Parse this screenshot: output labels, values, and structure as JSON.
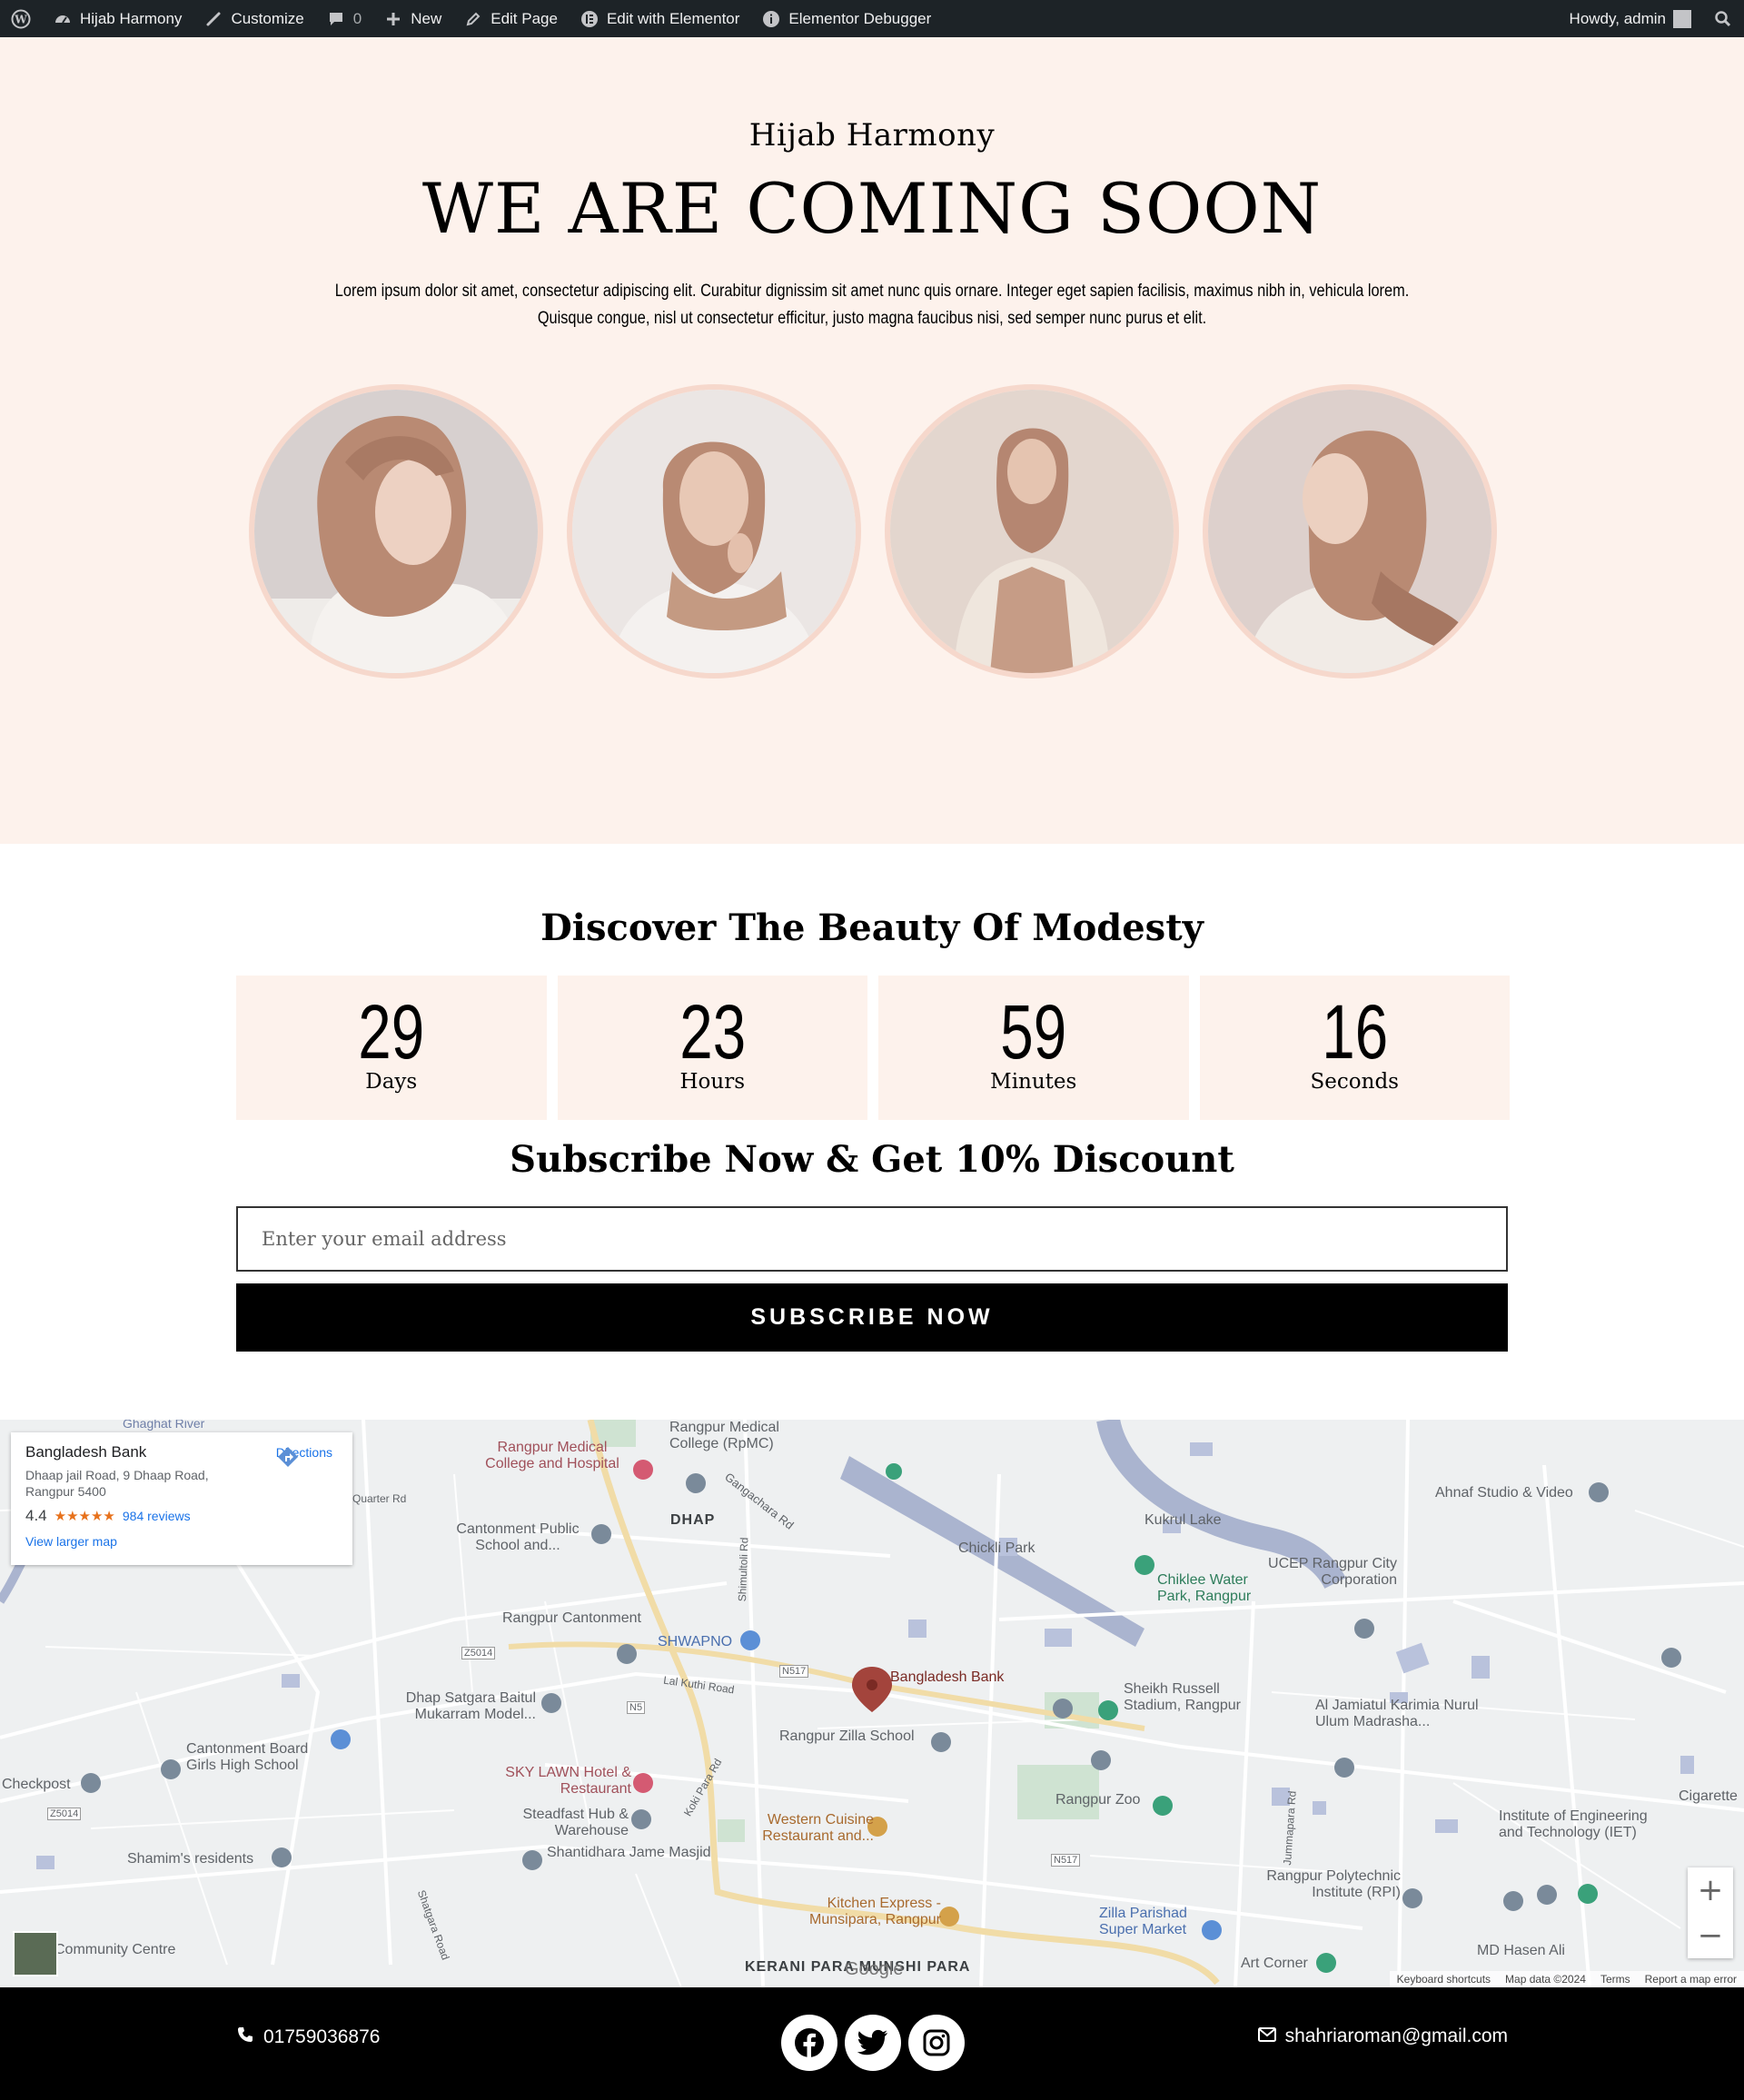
{
  "adminbar": {
    "site_name": "Hijab Harmony",
    "customize": "Customize",
    "comments_count": "0",
    "new": "New",
    "edit_page": "Edit Page",
    "edit_elementor": "Edit with Elementor",
    "debugger": "Elementor Debugger",
    "howdy": "Howdy, admin"
  },
  "hero": {
    "brand": "Hijab Harmony",
    "headline": "WE ARE COMING SOON",
    "description": "Lorem ipsum dolor sit amet, consectetur adipiscing elit. Curabitur dignissim sit amet nunc quis ornare. Integer eget sapien facilisis, maximus nibh in, vehicula lorem. Quisque congue, nisl ut consectetur efficitur, justo magna faucibus nisi, sed semper nunc purus et elit."
  },
  "countdown": {
    "title": "Discover The Beauty Of Modesty",
    "items": [
      {
        "value": "29",
        "label": "Days"
      },
      {
        "value": "23",
        "label": "Hours"
      },
      {
        "value": "59",
        "label": "Minutes"
      },
      {
        "value": "16",
        "label": "Seconds"
      }
    ]
  },
  "subscribe": {
    "title": "Subscribe Now & Get 10% Discount",
    "placeholder": "Enter your email address",
    "button": "SUBSCRIBE NOW"
  },
  "map": {
    "card": {
      "name": "Bangladesh Bank",
      "address": "Dhaap jail Road, 9 Dhaap Road, Rangpur 5400",
      "rating": "4.4",
      "stars": "★★★★★",
      "reviews": "984 reviews",
      "larger_map": "View larger map",
      "directions": "Directions"
    },
    "labels": {
      "medical": "Rangpur Medical College (RpMC)",
      "hospital": "Rangpur Medical College and Hospital",
      "dhap": "DHAP",
      "gangachara": "Gangachara Rd",
      "chickli": "Chickli Park",
      "kukrul": "Kukrul Lake",
      "ahnaf": "Ahnaf Studio & Video",
      "ucep": "UCEP Rangpur City Corporation",
      "chiklee": "Chiklee Water Park, Rangpur",
      "cantonment_school": "Cantonment Public School and...",
      "rangpur_cantonment": "Rangpur Cantonment",
      "shwapno": "SHWAPNO",
      "bangladesh_bank": "Bangladesh Bank",
      "sheikh_russell": "Sheikh Russell Stadium, Rangpur",
      "dhap_satgara": "Dhap Satgara Baitul Mukarram Model...",
      "al_jamiatul": "Al Jamiatul Karimia Nurul Ulum Madrasha...",
      "zilla_school": "Rangpur Zilla School",
      "cantonment_board": "Cantonment Board Girls High School",
      "checkpost": "Checkpost",
      "sky_lawn": "SKY LAWN Hotel & Restaurant",
      "rangpur_zoo": "Rangpur Zoo",
      "steadfast": "Steadfast Hub & Warehouse",
      "western": "Western Cuisine Restaurant and...",
      "institute": "Institute of Engineering and Technology (IET)",
      "cigarette": "Cigarette",
      "shamim": "Shamim's residents",
      "shantidhara": "Shantidhara Jame Masjid",
      "polytechnic": "Rangpur Polytechnic Institute (RPI)",
      "kitchen": "Kitchen Express - Munsipara, Rangpur",
      "zilla_parishad": "Zilla Parishad Super Market",
      "art_corner": "Art Corner",
      "md_hasen": "MD Hasen Ali",
      "kerani": "KERANI PARA MUNSHI PARA",
      "community": "Community Centre",
      "lal_kuthi": "Lal Kuthi Road",
      "shimultoli": "Shimultoli Rd",
      "koki_para": "Koki Para Rd",
      "jummapara": "Jummapara Rd",
      "ghaghat": "Ghaghat River",
      "quarter_rd": "Quarter Rd",
      "z5014": "Z5014",
      "n517": "N517",
      "n5": "N5",
      "shatgara": "Shatgara Road"
    },
    "zoom_in": "+",
    "zoom_out": "−",
    "google": "Google",
    "keyboard": "Keyboard shortcuts",
    "map_data": "Map data ©2024",
    "terms": "Terms",
    "report": "Report a map error"
  },
  "footer": {
    "phone": "01759036876",
    "email": "shahriaroman@gmail.com"
  },
  "colors": {
    "hero_bg": "#fdf2ec",
    "adminbar_bg": "#1d2327",
    "footer_bg": "#000000",
    "circle_border": "#f6d8cc"
  }
}
